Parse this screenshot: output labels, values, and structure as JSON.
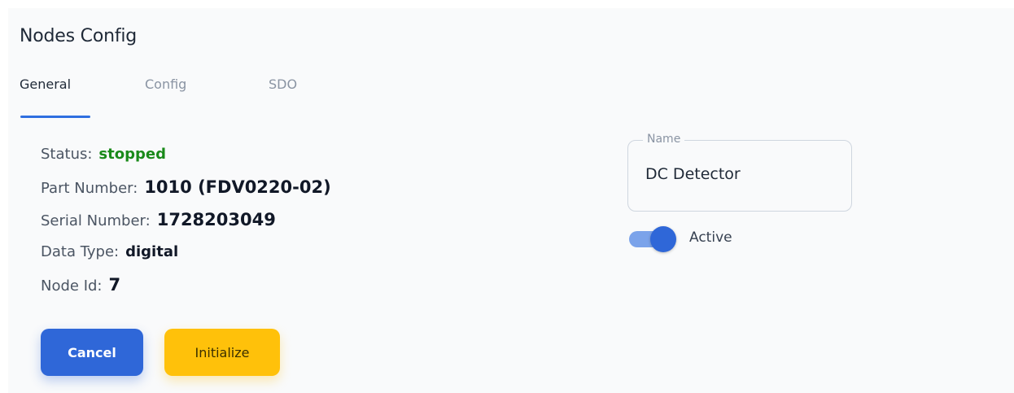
{
  "panel": {
    "title": "Nodes Config"
  },
  "tabs": [
    {
      "label": "General",
      "active": true
    },
    {
      "label": "Config",
      "active": false
    },
    {
      "label": "SDO",
      "active": false
    }
  ],
  "details": {
    "status_label": "Status:",
    "status_value": "stopped",
    "part_number_label": "Part Number:",
    "part_number_value": "1010 (FDV0220-02)",
    "serial_number_label": "Serial Number:",
    "serial_number_value": "1728203049",
    "data_type_label": "Data Type:",
    "data_type_value": "digital",
    "node_id_label": "Node Id:",
    "node_id_value": "7"
  },
  "name_field": {
    "label": "Name",
    "value": "DC Detector"
  },
  "active_toggle": {
    "label": "Active",
    "checked": true
  },
  "actions": {
    "cancel_label": "Cancel",
    "initialize_label": "Initialize"
  },
  "colors": {
    "accent": "#2f67d8",
    "status_green": "#1a8a1a",
    "initialize_yellow": "#ffc10a"
  }
}
